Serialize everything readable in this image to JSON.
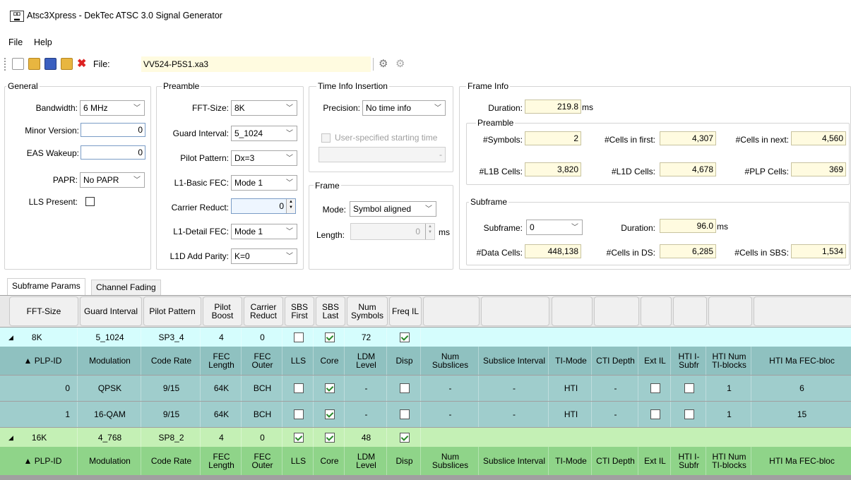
{
  "window": {
    "title": "Atsc3Xpress - DekTec ATSC 3.0 Signal Generator",
    "app_icon": "app-logo-icon"
  },
  "menu": {
    "file": "File",
    "help": "Help"
  },
  "toolbar": {
    "file_label": "File:",
    "file_value": "VV524-P5S1.xa3"
  },
  "general": {
    "title": "General",
    "bandwidth_label": "Bandwidth:",
    "bandwidth_value": "6 MHz",
    "minor_version_label": "Minor Version:",
    "minor_version_value": "0",
    "eas_wakeup_label": "EAS Wakeup:",
    "eas_wakeup_value": "0",
    "papr_label": "PAPR:",
    "papr_value": "No PAPR",
    "lls_label": "LLS Present:"
  },
  "preamble": {
    "title": "Preamble",
    "fft_label": "FFT-Size:",
    "fft_value": "8K",
    "guard_label": "Guard Interval:",
    "guard_value": "5_1024",
    "pilot_label": "Pilot Pattern:",
    "pilot_value": "Dx=3",
    "l1b_fec_label": "L1-Basic FEC:",
    "l1b_fec_value": "Mode 1",
    "carrier_label": "Carrier Reduct:",
    "carrier_value": "0",
    "l1d_fec_label": "L1-Detail FEC:",
    "l1d_fec_value": "Mode 1",
    "l1d_parity_label": "L1D Add Parity:",
    "l1d_parity_value": "K=0"
  },
  "time_info": {
    "title": "Time Info Insertion",
    "precision_label": "Precision:",
    "precision_value": "No time info",
    "user_start_label": "User-specified starting time"
  },
  "frame": {
    "title": "Frame",
    "mode_label": "Mode:",
    "mode_value": "Symbol aligned",
    "length_label": "Length:",
    "length_value": "0",
    "length_unit": "ms"
  },
  "frame_info": {
    "title": "Frame Info",
    "duration_label": "Duration:",
    "duration_value": "219.8",
    "duration_unit": "ms",
    "preamble_title": "Preamble",
    "symbols_label": "#Symbols:",
    "symbols_value": "2",
    "cells_first_label": "#Cells in first:",
    "cells_first_value": "4,307",
    "cells_next_label": "#Cells in next:",
    "cells_next_value": "4,560",
    "l1b_cells_label": "#L1B Cells:",
    "l1b_cells_value": "3,820",
    "l1d_cells_label": "#L1D Cells:",
    "l1d_cells_value": "4,678",
    "plp_cells_label": "#PLP Cells:",
    "plp_cells_value": "369",
    "subframe_title": "Subframe",
    "subframe_label": "Subframe:",
    "subframe_value": "0",
    "sf_duration_label": "Duration:",
    "sf_duration_value": "96.0",
    "sf_duration_unit": "ms",
    "data_cells_label": "#Data Cells:",
    "data_cells_value": "448,138",
    "cells_ds_label": "#Cells in DS:",
    "cells_ds_value": "6,285",
    "cells_sbs_label": "#Cells in SBS:",
    "cells_sbs_value": "1,534"
  },
  "tabs": {
    "subframe_params": "Subframe Params",
    "channel_fading": "Channel Fading"
  },
  "grid": {
    "headers": [
      "FFT-Size",
      "Guard Interval",
      "Pilot Pattern",
      "Pilot Boost",
      "Carrier Reduct",
      "SBS First",
      "SBS Last",
      "Num Symbols",
      "Freq IL"
    ],
    "plp_headers": [
      "▲ PLP-ID",
      "Modulation",
      "Code Rate",
      "FEC Length",
      "FEC Outer",
      "LLS",
      "Core",
      "LDM Level",
      "Disp",
      "Num Subslices",
      "Subslice Interval",
      "TI-Mode",
      "CTI Depth",
      "Ext IL",
      "HTI I-Subfr",
      "HTI Num TI-blocks",
      "HTI Ma FEC-bloc"
    ],
    "subframes": [
      {
        "fft": "8K",
        "guard": "5_1024",
        "pilot": "SP3_4",
        "boost": "4",
        "carrier": "0",
        "sbs_first": false,
        "sbs_last": true,
        "num_symbols": "72",
        "freq_il": true,
        "plps": [
          {
            "id": "0",
            "mod": "QPSK",
            "rate": "9/15",
            "fec_len": "64K",
            "fec_outer": "BCH",
            "lls": false,
            "core": true,
            "ldm": "-",
            "disp": false,
            "num_ss": "-",
            "ss_int": "-",
            "ti_mode": "HTI",
            "cti": "-",
            "ext_il": false,
            "hti_isubfr": false,
            "hti_num": "1",
            "hti_max": "6"
          },
          {
            "id": "1",
            "mod": "16-QAM",
            "rate": "9/15",
            "fec_len": "64K",
            "fec_outer": "BCH",
            "lls": false,
            "core": true,
            "ldm": "-",
            "disp": false,
            "num_ss": "-",
            "ss_int": "-",
            "ti_mode": "HTI",
            "cti": "-",
            "ext_il": false,
            "hti_isubfr": false,
            "hti_num": "1",
            "hti_max": "15"
          }
        ]
      },
      {
        "fft": "16K",
        "guard": "4_768",
        "pilot": "SP8_2",
        "boost": "4",
        "carrier": "0",
        "sbs_first": true,
        "sbs_last": true,
        "num_symbols": "48",
        "freq_il": true
      }
    ]
  }
}
